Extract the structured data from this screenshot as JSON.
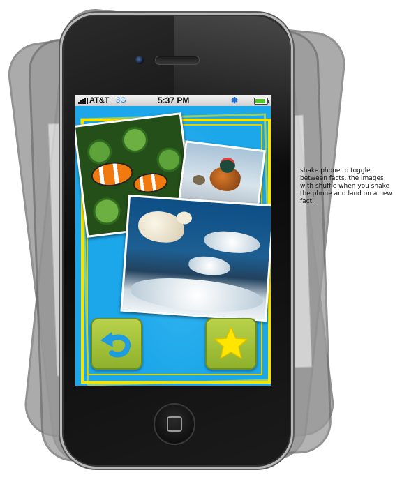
{
  "status_bar": {
    "carrier": "AT&T",
    "network": "3G",
    "time": "5:37 PM",
    "bluetooth_icon": "bluetooth-icon",
    "battery_level": 0.85
  },
  "photos": [
    {
      "subject": "clownfish"
    },
    {
      "subject": "mandarin-duck"
    },
    {
      "subject": "polar-bear"
    }
  ],
  "buttons": {
    "back_icon": "undo-arrow-icon",
    "favorite_icon": "star-icon"
  },
  "colors": {
    "screen_background": "#1ba7ea",
    "frame_yellow": "#f5e400",
    "button_green": "#a6c23c",
    "star_yellow": "#ffe600",
    "arrow_blue": "#1f9be0"
  },
  "annotation": {
    "text": "shake phone to toggle between facts. the images with shuffle when you shake the phone and land on a new fact."
  }
}
